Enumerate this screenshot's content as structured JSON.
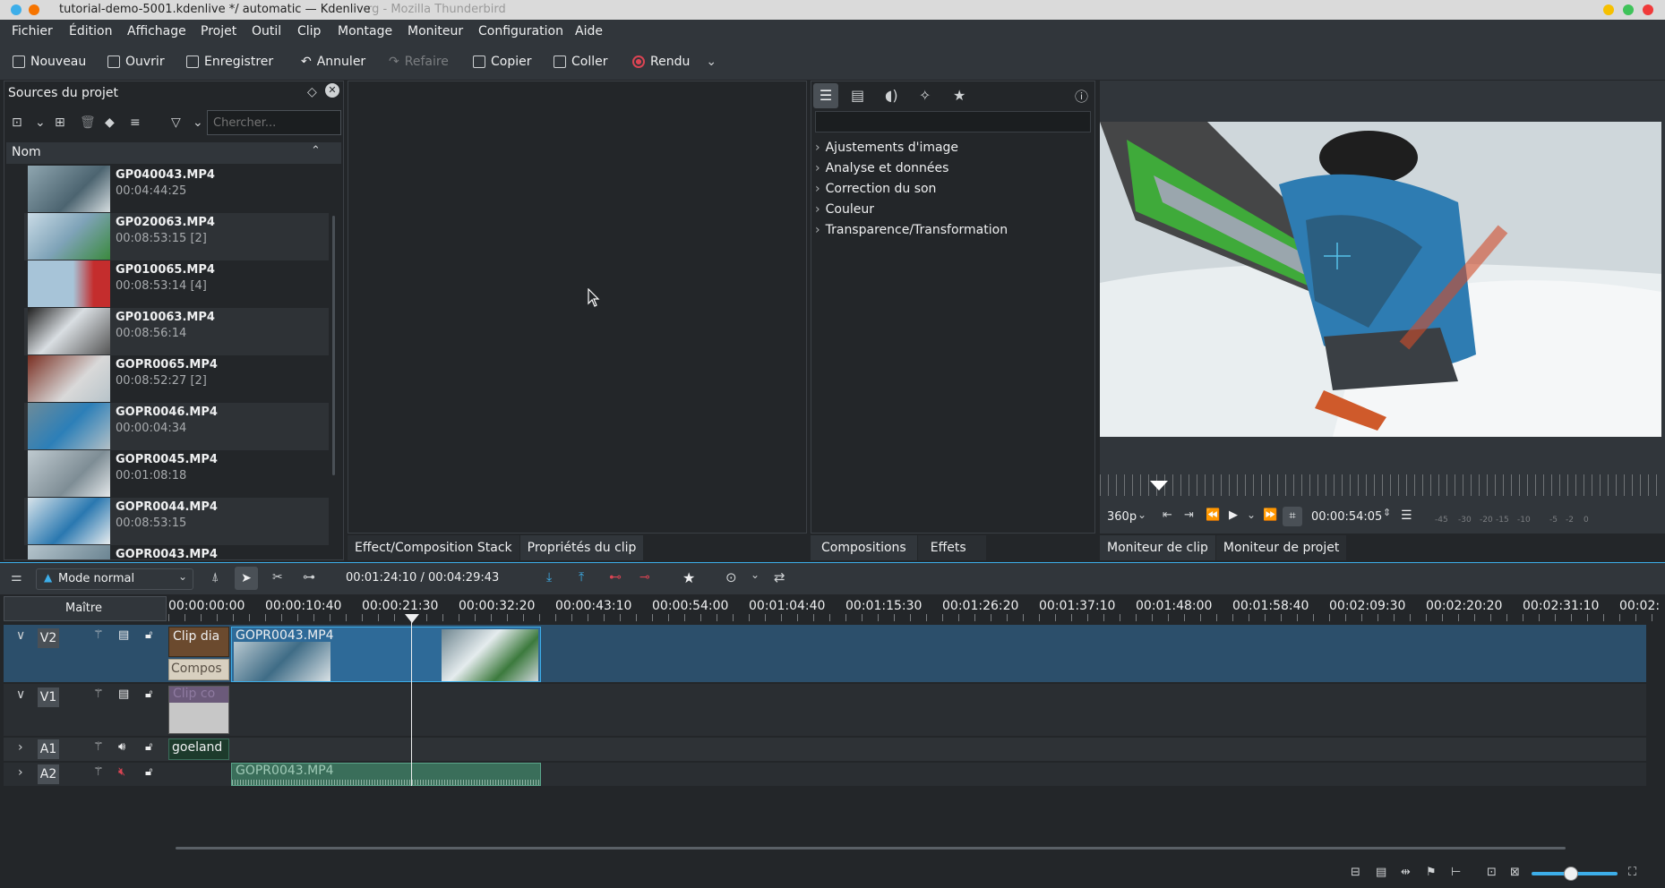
{
  "window": {
    "title": "tutorial-demo-5001.kdenlive */ automatic — Kdenlive",
    "background_title": "rg - Mozilla Thunderbird"
  },
  "menu": [
    "Fichier",
    "Édition",
    "Affichage",
    "Projet",
    "Outil",
    "Clip",
    "Montage",
    "Moniteur",
    "Configuration",
    "Aide"
  ],
  "toolbar": {
    "new": "Nouveau",
    "open": "Ouvrir",
    "save": "Enregistrer",
    "undo": "Annuler",
    "redo": "Refaire",
    "copy": "Copier",
    "paste": "Coller",
    "render": "Rendu"
  },
  "project_bin": {
    "title": "Sources du projet",
    "search_placeholder": "Chercher...",
    "column": "Nom",
    "clips": [
      {
        "name": "GP040043.MP4",
        "duration": "00:04:44:25"
      },
      {
        "name": "GP020063.MP4",
        "duration": "00:08:53:15 [2]"
      },
      {
        "name": "GP010065.MP4",
        "duration": "00:08:53:14 [4]"
      },
      {
        "name": "GP010063.MP4",
        "duration": "00:08:56:14"
      },
      {
        "name": "GOPR0065.MP4",
        "duration": "00:08:52:27 [2]"
      },
      {
        "name": "GOPR0046.MP4",
        "duration": "00:00:04:34"
      },
      {
        "name": "GOPR0045.MP4",
        "duration": "00:01:08:18"
      },
      {
        "name": "GOPR0044.MP4",
        "duration": "00:08:53:15"
      },
      {
        "name": "GOPR0043.MP4",
        "duration": ""
      }
    ]
  },
  "middle_tabs": [
    "Effect/Composition Stack",
    "Propriétés du clip"
  ],
  "effects": {
    "categories": [
      "Ajustements d'image",
      "Analyse et données",
      "Correction du son",
      "Couleur",
      "Transparence/Transformation"
    ],
    "tabs": [
      "Compositions",
      "Effets"
    ]
  },
  "monitor": {
    "resolution": "360p",
    "timecode": "00:00:54:05",
    "audio_scale": [
      "-45",
      "-30",
      "-20",
      "-15",
      "-10",
      "-5",
      "-2",
      "0"
    ],
    "tabs": [
      "Moniteur de clip",
      "Moniteur de projet"
    ]
  },
  "timeline": {
    "mode": "Mode normal",
    "position": "00:01:24:10 / 00:04:29:43",
    "master": "Maître",
    "ruler": [
      "00:00:00:00",
      "00:00:10:40",
      "00:00:21:30",
      "00:00:32:20",
      "00:00:43:10",
      "00:00:54:00",
      "00:01:04:40",
      "00:01:15:30",
      "00:01:26:20",
      "00:01:37:10",
      "00:01:48:00",
      "00:01:58:40",
      "00:02:09:30",
      "00:02:20:20",
      "00:02:31:10",
      "00:02:"
    ],
    "tracks": [
      "V2",
      "V1",
      "A1",
      "A2"
    ],
    "clips": {
      "v2_title_clip": "Clip dia",
      "v2_composition": "Compos",
      "v2_main_clip": "GOPR0043.MP4",
      "v1_clip": "Clip co",
      "a1_clip": "goeland",
      "a2_clip": "GOPR0043.MP4"
    }
  },
  "colors": {
    "accent": "#3daee9",
    "track_selected": "#2c4f6b",
    "clip_video": "#2e6a98",
    "clip_audio": "#3a6e5a"
  }
}
